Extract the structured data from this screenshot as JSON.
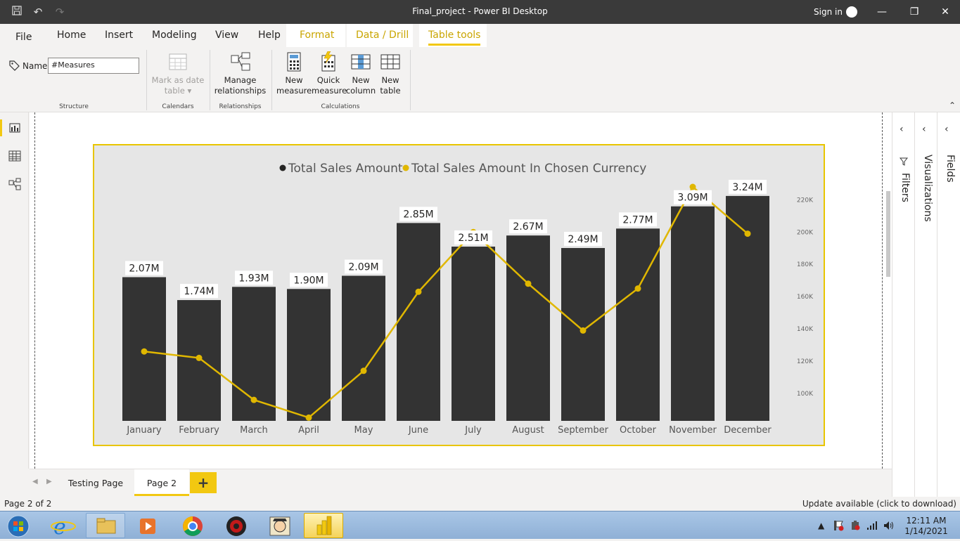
{
  "window": {
    "title": "Final_project - Power BI Desktop",
    "sign_in": "Sign in"
  },
  "ribbon_tabs": [
    "File",
    "Home",
    "Insert",
    "Modeling",
    "View",
    "Help",
    "Format",
    "Data / Drill",
    "Table tools"
  ],
  "active_tab": "Table tools",
  "ribbon": {
    "name_label": "Name",
    "name_value": "#Measures",
    "mark_as_date_table": [
      "Mark as date",
      "table"
    ],
    "manage_relationships": [
      "Manage",
      "relationships"
    ],
    "new_measure": [
      "New",
      "measure"
    ],
    "quick_measure": [
      "Quick",
      "measure"
    ],
    "new_column": [
      "New",
      "column"
    ],
    "new_table": [
      "New",
      "table"
    ],
    "groups": {
      "structure": "Structure",
      "calendars": "Calendars",
      "relationships": "Relationships",
      "calculations": "Calculations"
    }
  },
  "right_panes": {
    "filters": "Filters",
    "visualizations": "Visualizations",
    "fields": "Fields"
  },
  "pages": {
    "tabs": [
      "Testing Page",
      "Page 2"
    ],
    "active": "Page 2",
    "add_label": "+"
  },
  "status": {
    "page_indicator": "Page 2 of 2",
    "update": "Update available (click to download)"
  },
  "taskbar": {
    "time": "12:11 AM",
    "date": "1/14/2021"
  },
  "colors": {
    "bar": "#333333",
    "line": "#e0b700",
    "accent": "#f2c811",
    "titlebar": "#3a3a3a"
  },
  "chart_data": {
    "type": "bar",
    "categories": [
      "January",
      "February",
      "March",
      "April",
      "May",
      "June",
      "July",
      "August",
      "September",
      "October",
      "November",
      "December"
    ],
    "series": [
      {
        "name": "Total Sales Amount",
        "type": "bar",
        "values": [
          2.07,
          1.74,
          1.93,
          1.9,
          2.09,
          2.85,
          2.51,
          2.67,
          2.49,
          2.77,
          3.09,
          3.24
        ],
        "labels": [
          "2.07M",
          "1.74M",
          "1.93M",
          "1.90M",
          "2.09M",
          "2.85M",
          "2.51M",
          "2.67M",
          "2.49M",
          "2.77M",
          "3.09M",
          "3.24M"
        ]
      },
      {
        "name": "Total Sales Amount In Chosen Currency",
        "type": "line",
        "axis": "right",
        "values": [
          126000,
          122000,
          96000,
          85000,
          114000,
          163000,
          200000,
          168000,
          139000,
          165000,
          228000,
          199000
        ]
      }
    ],
    "y2_ticks": [
      "100K",
      "120K",
      "140K",
      "160K",
      "180K",
      "200K",
      "220K"
    ],
    "y2_tick_values": [
      100000,
      120000,
      140000,
      160000,
      180000,
      200000,
      220000
    ],
    "y2lim": [
      83000,
      228000
    ],
    "legend": "top-center",
    "grid": false
  }
}
